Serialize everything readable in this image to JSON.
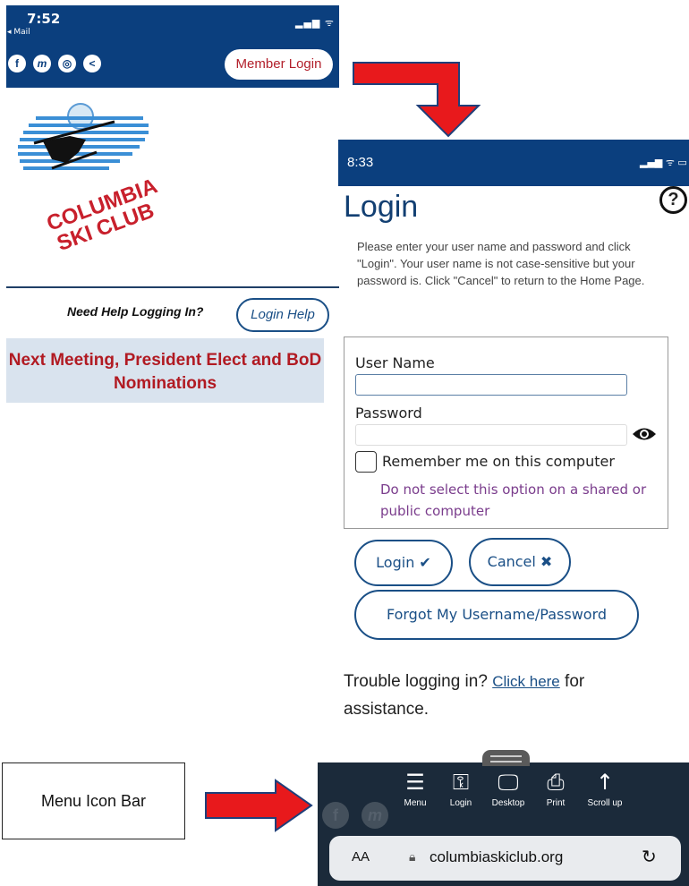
{
  "screen1": {
    "time": "7:52",
    "back_label": "◂ Mail",
    "signal_text": "▂▄▆ ᯤ ▭",
    "social_icons": [
      "f",
      "m",
      "◎",
      "<"
    ],
    "member_login_label": "Member Login",
    "logo_line1": "COLUMBIA",
    "logo_line2": "SKI CLUB",
    "help_question": "Need Help Logging In?",
    "login_help_label": "Login Help",
    "meeting_banner": "Next Meeting, President Elect and BoD Nominations"
  },
  "screen2": {
    "time": "8:33",
    "signal_text": "▂▄▆ ᯤ ▭",
    "title": "Login",
    "help_icon_text": "?",
    "instructions": "Please enter your user name and password and click \"Login\". Your user name is not case-sensitive but your password is. Click \"Cancel\" to return to the Home Page.",
    "username_label": "User Name",
    "password_label": "Password",
    "remember_label": "Remember me on this computer",
    "shared_note": "Do not select this option on a shared or public computer",
    "login_button": "Login ✔",
    "cancel_button": "Cancel ✖",
    "forgot_button": "Forgot My Username/Password",
    "trouble_prefix": "Trouble logging in? ",
    "trouble_link": "Click here",
    "trouble_suffix": " for assistance."
  },
  "screen3": {
    "menu_items": [
      {
        "label": "Menu",
        "icon": "menu-icon",
        "glyph": "☰"
      },
      {
        "label": "Login",
        "icon": "key-icon",
        "glyph": "⚿"
      },
      {
        "label": "Desktop",
        "icon": "desktop-icon",
        "glyph": "🖵"
      },
      {
        "label": "Print",
        "icon": "printer-icon",
        "glyph": "⎙"
      },
      {
        "label": "Scroll up",
        "icon": "arrow-up-icon",
        "glyph": "↑"
      }
    ],
    "text_size_label": "AA",
    "url": "columbiaskiclub.org",
    "reload_glyph": "↻"
  },
  "callout_label": "Menu Icon Bar",
  "colors": {
    "brand_blue": "#0b3f7e",
    "brand_red": "#b21f2a",
    "arrow_red": "#e8191c",
    "link_purple": "#7a3c8c"
  }
}
